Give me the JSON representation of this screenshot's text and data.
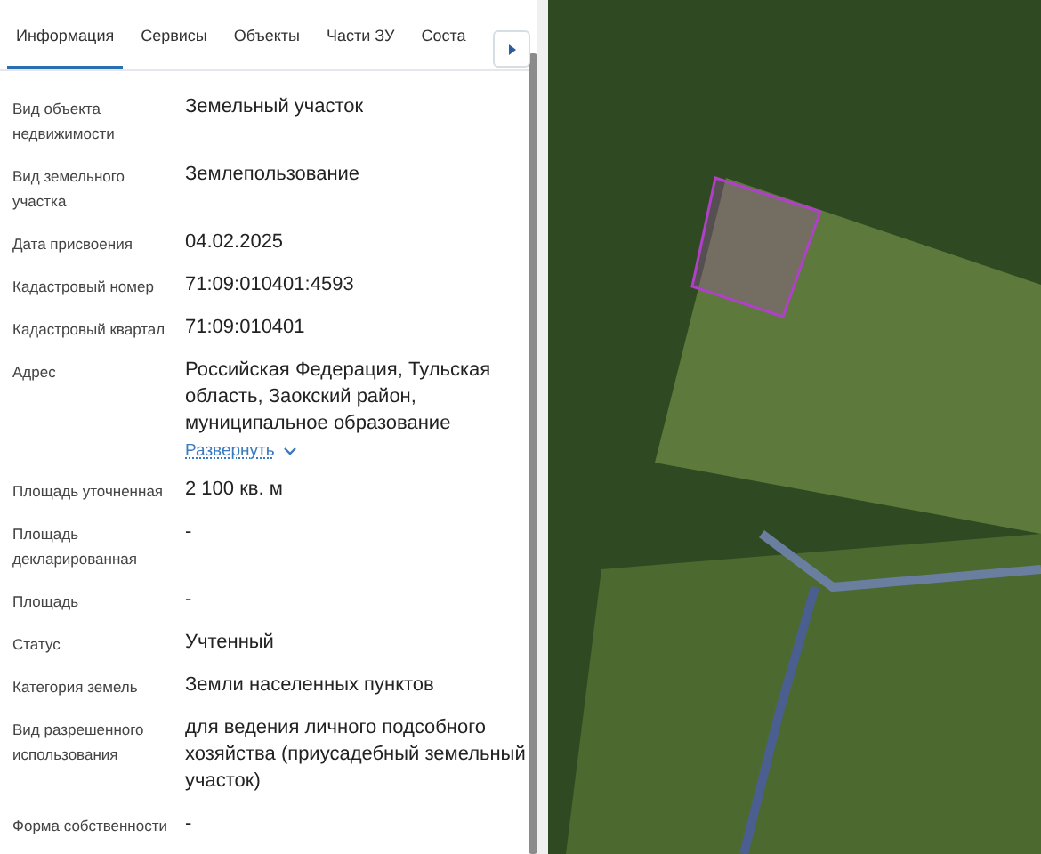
{
  "tabs": [
    {
      "label": "Информация",
      "selected": true
    },
    {
      "label": "Сервисы",
      "selected": false
    },
    {
      "label": "Объекты",
      "selected": false
    },
    {
      "label": "Части ЗУ",
      "selected": false
    },
    {
      "label": "Соста",
      "selected": false
    }
  ],
  "rows": [
    {
      "label": "Вид объекта недвижимости",
      "value": "Земельный участок"
    },
    {
      "label": "Вид земельного участка",
      "value": "Землепользование"
    },
    {
      "label": "Дата присвоения",
      "value": "04.02.2025"
    },
    {
      "label": "Кадастровый номер",
      "value": "71:09:010401:4593"
    },
    {
      "label": "Кадастровый квартал",
      "value": "71:09:010401"
    },
    {
      "label": "Адрес",
      "value": "Российская Федерация, Тульская\nобласть, Заокский район,\nмуниципальное образование",
      "expand_link": "Развернуть"
    },
    {
      "label": "Площадь уточненная",
      "value": "2 100 кв. м"
    },
    {
      "label": "Площадь декларированная",
      "value": "-"
    },
    {
      "label": "Площадь",
      "value": "-"
    },
    {
      "label": "Статус",
      "value": "Учтенный"
    },
    {
      "label": "Категория земель",
      "value": "Земли населенных пунктов"
    },
    {
      "label": "Вид разрешенного использования",
      "value": "для ведения личного подсобного\nхозяйства (приусадебный земельный\nучасток)"
    },
    {
      "label": "Форма собственности",
      "value": "-"
    }
  ]
}
